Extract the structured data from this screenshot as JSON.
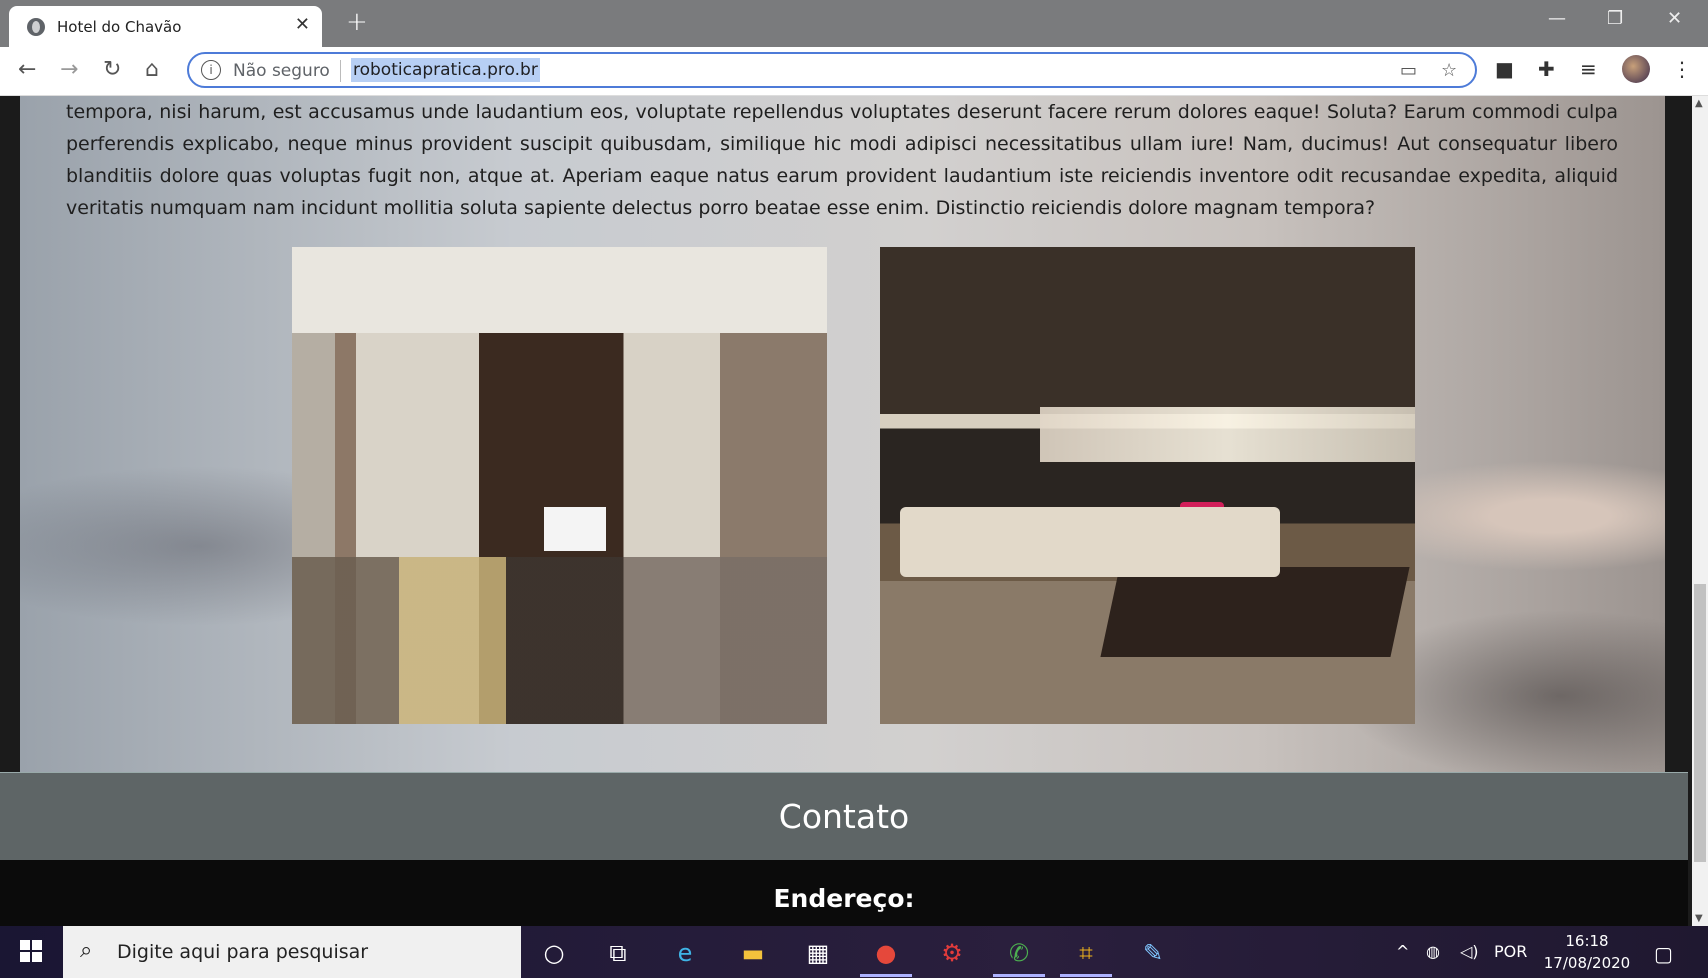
{
  "browser": {
    "tab_title": "Hotel do Chavão",
    "security_label": "Não seguro",
    "url": "roboticapratica.pro.br"
  },
  "page": {
    "paragraph": "tempora, nisi harum, est accusamus unde laudantium eos, voluptate repellendus voluptates deserunt facere rerum dolores eaque! Soluta? Earum commodi culpa perferendis explicabo, neque minus provident suscipit quibusdam, similique hic modi adipisci necessitatibus ullam iure! Nam, ducimus! Aut consequatur libero blanditiis dolore quas voluptas fugit non, atque at. Aperiam eaque natus earum provident laudantium iste reiciendis inventore odit recusandae expedita, aliquid veritatis numquam nam incidunt mollitia soluta sapiente delectus porro beatae esse enim. Distinctio reiciendis dolore magnam tempora?",
    "contact_heading": "Contato",
    "address_label": "Endereço:"
  },
  "taskbar": {
    "search_placeholder": "Digite aqui para pesquisar",
    "language": "POR",
    "time": "16:18",
    "date": "17/08/2020"
  },
  "colors": {
    "contact_bar": "#5e6566",
    "footer": "#0b0b0b",
    "omnibox_focus": "#4d7bd8"
  }
}
